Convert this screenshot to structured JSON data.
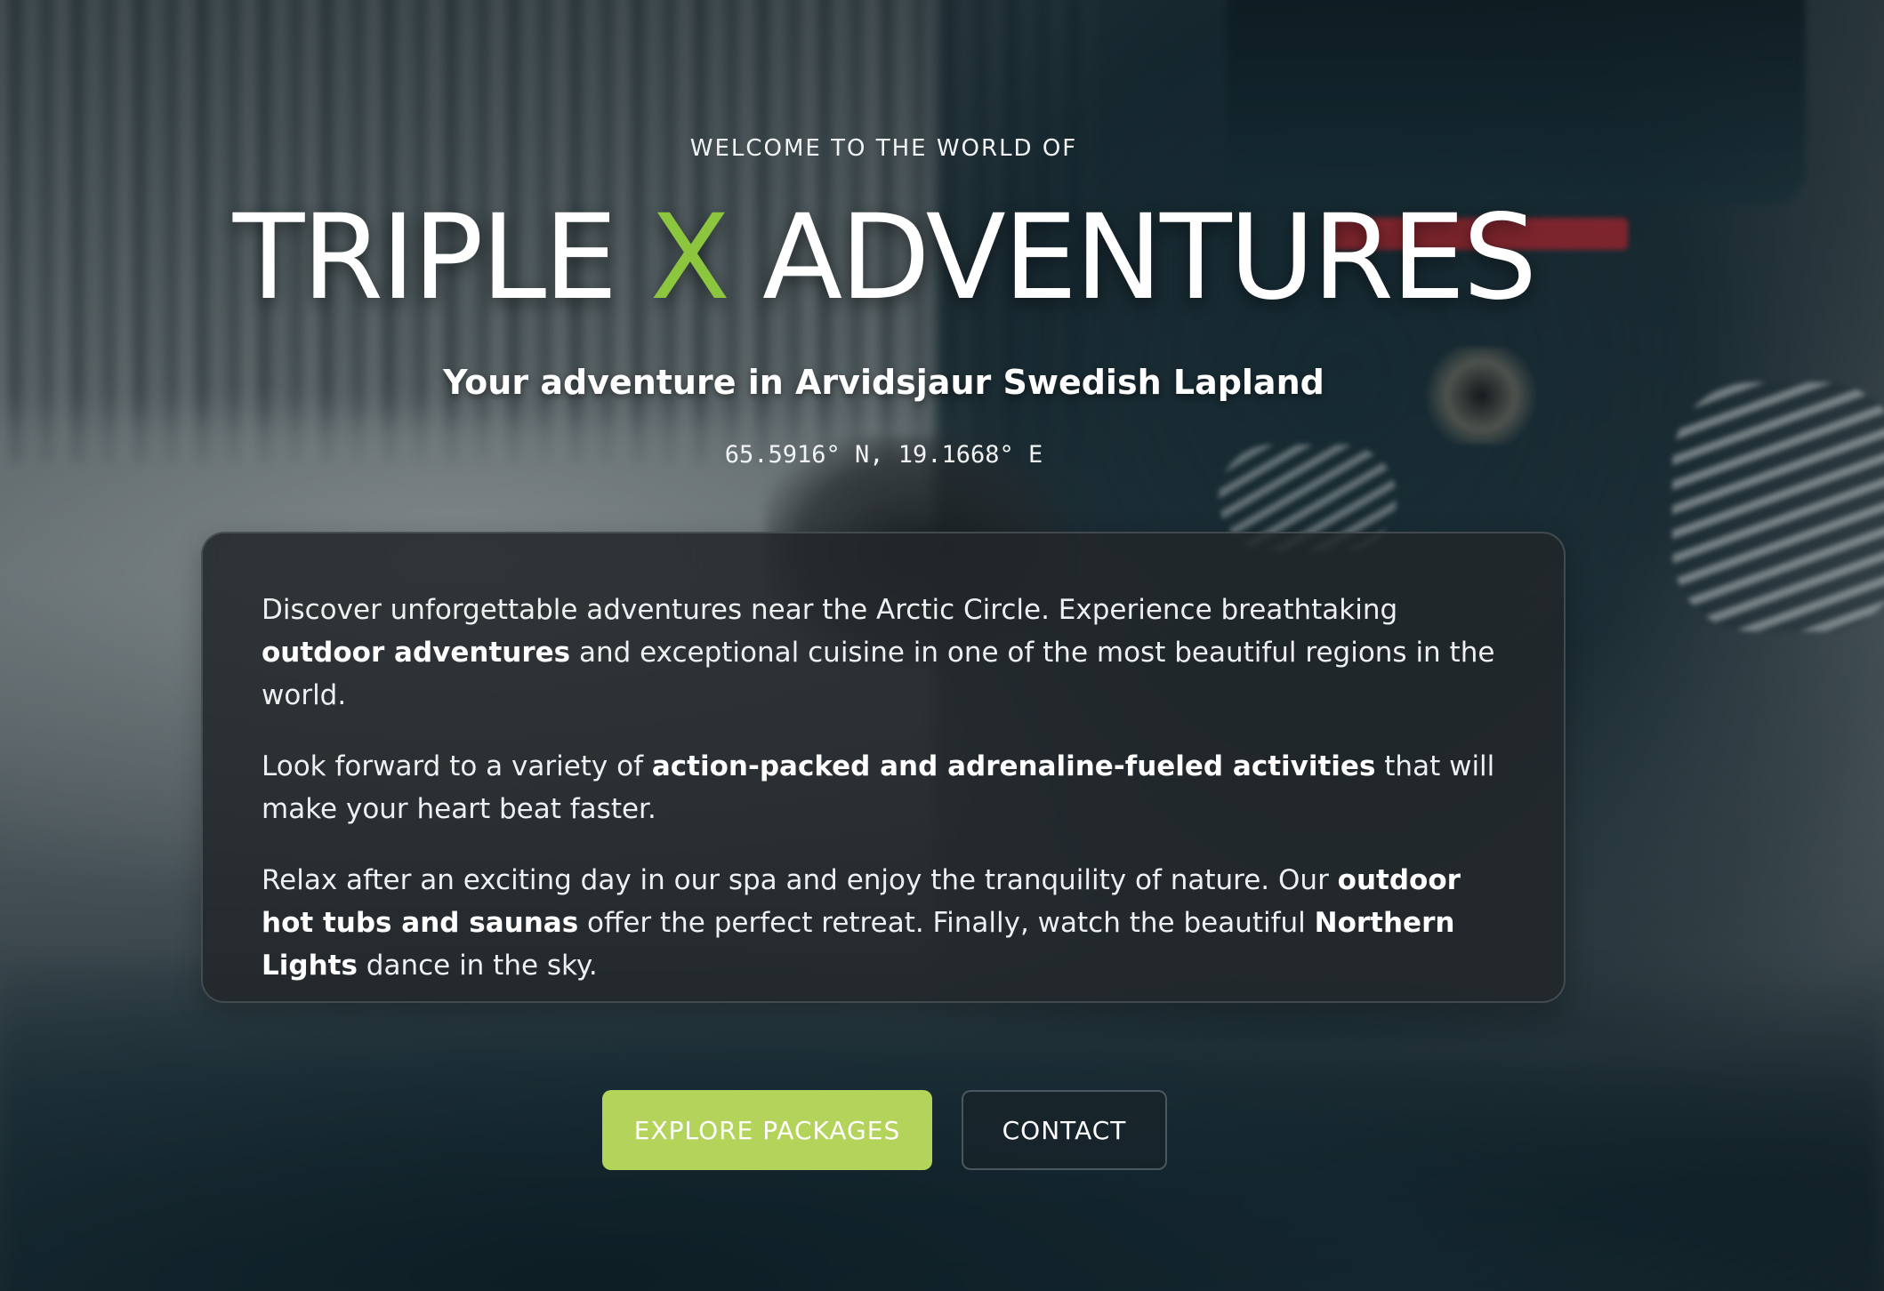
{
  "hero": {
    "eyebrow": "WELCOME TO THE WORLD OF",
    "title_part1": "TRIPLE",
    "title_accent": "X",
    "title_part2": "ADVENTURES",
    "subtitle": "Your adventure in Arvidsjaur Swedish Lapland",
    "coordinates": "65.5916° N, 19.1668° E"
  },
  "intro_card": {
    "p1_a": "Discover unforgettable adventures near the Arctic Circle. Experience breathtaking ",
    "p1_b": "outdoor adventures",
    "p1_c": " and exceptional cuisine in one of the most beautiful regions in the world.",
    "p2_a": "Look forward to a variety of ",
    "p2_b": "action-packed and adrenaline-fueled activities",
    "p2_c": " that will make your heart beat faster.",
    "p3_a": "Relax after an exciting day in our spa and enjoy the tranquility of nature. Our ",
    "p3_b": "outdoor hot tubs and saunas",
    "p3_c": " offer the perfect retreat. Finally, watch the beautiful ",
    "p3_d": "Northern Lights",
    "p3_e": " dance in the sky."
  },
  "actions": {
    "primary_label": "EXPLORE PACKAGES",
    "secondary_label": "CONTACT"
  },
  "colors": {
    "accent_green": "#8cc63f",
    "button_green": "#b3d35a",
    "card_background": "#22262a"
  }
}
